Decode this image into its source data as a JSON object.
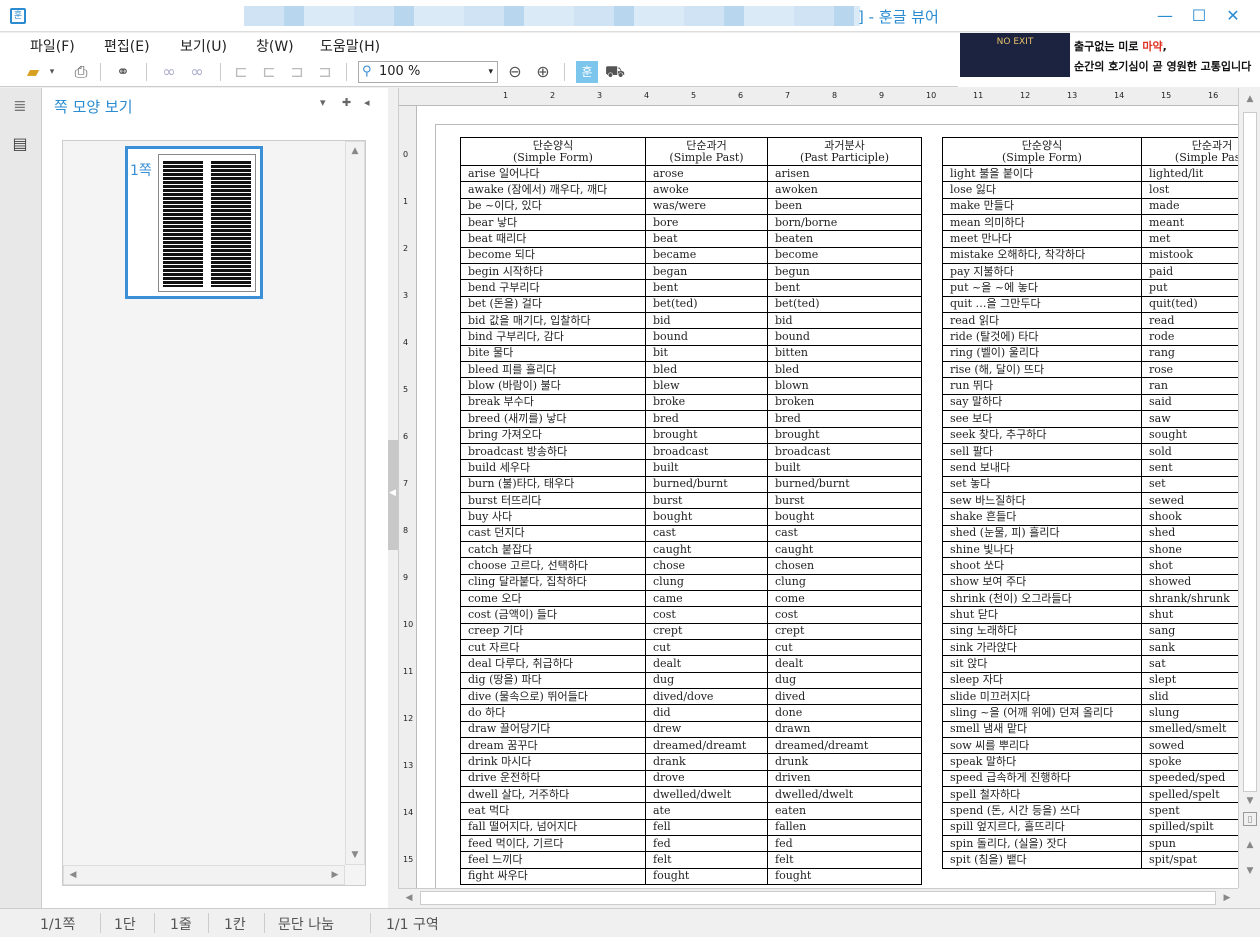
{
  "window": {
    "title_suffix": "] - 훈글 뷰어"
  },
  "menu": [
    "파일(F)",
    "편집(E)",
    "보기(U)",
    "창(W)",
    "도움말(H)"
  ],
  "toolbar": {
    "zoom": "100 %"
  },
  "ad": {
    "line1_prefix": "출구없는 미로 ",
    "line1_highlight": "마약",
    "line1_suffix": ",",
    "line2": "순간의 호기심이 곧 영원한 고통입니다",
    "image_text": "NO EXIT"
  },
  "panel": {
    "title": "쪽 모양 보기",
    "page_label": "1쪽"
  },
  "ruler": {
    "h_ticks": [
      "1",
      "2",
      "3",
      "4",
      "5",
      "6",
      "7",
      "8",
      "9",
      "10",
      "11",
      "12",
      "13",
      "14",
      "15",
      "16"
    ],
    "v_ticks": [
      "0",
      "1",
      "2",
      "3",
      "4",
      "5",
      "6",
      "7",
      "8",
      "9",
      "10",
      "11",
      "12",
      "13",
      "14",
      "15"
    ]
  },
  "table1": {
    "headers": [
      [
        "단순양식",
        "(Simple Form)"
      ],
      [
        "단순과거",
        "(Simple Past)"
      ],
      [
        "과거분사",
        "(Past Participle)"
      ]
    ],
    "rows": [
      [
        "arise 일어나다",
        "arose",
        "arisen"
      ],
      [
        "awake (잠에서) 깨우다, 깨다",
        "awoke",
        "awoken"
      ],
      [
        "be ~이다, 있다",
        "was/were",
        "been"
      ],
      [
        "bear 낳다",
        "bore",
        "born/borne"
      ],
      [
        "beat 때리다",
        "beat",
        "beaten"
      ],
      [
        "become 되다",
        "became",
        "become"
      ],
      [
        "begin 시작하다",
        "began",
        "begun"
      ],
      [
        "bend 구부리다",
        "bent",
        "bent"
      ],
      [
        "bet (돈을) 걸다",
        "bet(ted)",
        "bet(ted)"
      ],
      [
        "bid 값을 매기다, 입찰하다",
        "bid",
        "bid"
      ],
      [
        "bind 구부리다, 감다",
        "bound",
        "bound"
      ],
      [
        "bite 물다",
        "bit",
        "bitten"
      ],
      [
        "bleed 피를 흘리다",
        "bled",
        "bled"
      ],
      [
        "blow (바람이) 불다",
        "blew",
        "blown"
      ],
      [
        "break 부수다",
        "broke",
        "broken"
      ],
      [
        "breed (새끼를) 낳다",
        "bred",
        "bred"
      ],
      [
        "bring 가져오다",
        "brought",
        "brought"
      ],
      [
        "broadcast 방송하다",
        "broadcast",
        "broadcast"
      ],
      [
        "build 세우다",
        "built",
        "built"
      ],
      [
        "burn (불)타다, 태우다",
        "burned/burnt",
        "burned/burnt"
      ],
      [
        "burst 터뜨리다",
        "burst",
        "burst"
      ],
      [
        "buy 사다",
        "bought",
        "bought"
      ],
      [
        "cast 던지다",
        "cast",
        "cast"
      ],
      [
        "catch 붙잡다",
        "caught",
        "caught"
      ],
      [
        "choose 고르다, 선택하다",
        "chose",
        "chosen"
      ],
      [
        "cling 달라붙다, 집착하다",
        "clung",
        "clung"
      ],
      [
        "come 오다",
        "came",
        "come"
      ],
      [
        "cost (금액이) 들다",
        "cost",
        "cost"
      ],
      [
        "creep 기다",
        "crept",
        "crept"
      ],
      [
        "cut 자르다",
        "cut",
        "cut"
      ],
      [
        "deal 다루다, 취급하다",
        "dealt",
        "dealt"
      ],
      [
        "dig (땅을) 파다",
        "dug",
        "dug"
      ],
      [
        "dive (물속으로) 뛰어들다",
        "dived/dove",
        "dived"
      ],
      [
        "do 하다",
        "did",
        "done"
      ],
      [
        "draw 끌어당기다",
        "drew",
        "drawn"
      ],
      [
        "dream 꿈꾸다",
        "dreamed/dreamt",
        "dreamed/dreamt"
      ],
      [
        "drink 마시다",
        "drank",
        "drunk"
      ],
      [
        "drive 운전하다",
        "drove",
        "driven"
      ],
      [
        "dwell 살다, 거주하다",
        "dwelled/dwelt",
        "dwelled/dwelt"
      ],
      [
        "eat 먹다",
        "ate",
        "eaten"
      ],
      [
        "fall 떨어지다, 넘어지다",
        "fell",
        "fallen"
      ],
      [
        "feed 먹이다, 기르다",
        "fed",
        "fed"
      ],
      [
        "feel 느끼다",
        "felt",
        "felt"
      ],
      [
        "fight 싸우다",
        "fought",
        "fought"
      ]
    ]
  },
  "table2": {
    "headers": [
      [
        "단순양식",
        "(Simple Form)"
      ],
      [
        "단순과거",
        "(Simple Past)"
      ]
    ],
    "rows": [
      [
        "light 불을 붙이다",
        "lighted/lit"
      ],
      [
        "lose 잃다",
        "lost"
      ],
      [
        "make 만들다",
        "made"
      ],
      [
        "mean 의미하다",
        "meant"
      ],
      [
        "meet 만나다",
        "met"
      ],
      [
        "mistake 오해하다, 착각하다",
        "mistook"
      ],
      [
        "pay 지불하다",
        "paid"
      ],
      [
        "put ~을 ~에 놓다",
        "put"
      ],
      [
        "quit …을 그만두다",
        "quit(ted)"
      ],
      [
        "read 읽다",
        "read"
      ],
      [
        "ride (탈것에) 타다",
        "rode"
      ],
      [
        "ring (벨이) 울리다",
        "rang"
      ],
      [
        "rise (해, 달이) 뜨다",
        "rose"
      ],
      [
        "run 뛰다",
        "ran"
      ],
      [
        "say 말하다",
        "said"
      ],
      [
        "see 보다",
        "saw"
      ],
      [
        "seek 찾다, 추구하다",
        "sought"
      ],
      [
        "sell 팔다",
        "sold"
      ],
      [
        "send 보내다",
        "sent"
      ],
      [
        "set 놓다",
        "set"
      ],
      [
        "sew 바느질하다",
        "sewed"
      ],
      [
        "shake 흔들다",
        "shook"
      ],
      [
        "shed (눈물, 피) 흘리다",
        "shed"
      ],
      [
        "shine 빛나다",
        "shone"
      ],
      [
        "shoot 쏘다",
        "shot"
      ],
      [
        "show 보여 주다",
        "showed"
      ],
      [
        "shrink (천이) 오그라들다",
        "shrank/shrunk"
      ],
      [
        "shut 닫다",
        "shut"
      ],
      [
        "sing 노래하다",
        "sang"
      ],
      [
        "sink 가라앉다",
        "sank"
      ],
      [
        "sit 앉다",
        "sat"
      ],
      [
        "sleep 자다",
        "slept"
      ],
      [
        "slide 미끄러지다",
        "slid"
      ],
      [
        "sling ~을 (어깨 위에) 던져 올리다",
        "slung"
      ],
      [
        "smell 냄새 맡다",
        "smelled/smelt"
      ],
      [
        "sow 씨를 뿌리다",
        "sowed"
      ],
      [
        "speak 말하다",
        "spoke"
      ],
      [
        "speed 급속하게 진행하다",
        "speeded/sped"
      ],
      [
        "spell 철자하다",
        "spelled/spelt"
      ],
      [
        "spend (돈, 시간 등을) 쓰다",
        "spent"
      ],
      [
        "spill 엎지르다, 흘뜨리다",
        "spilled/spilt"
      ],
      [
        "spin 돌리다, (실을) 잣다",
        "spun"
      ],
      [
        "spit (침을) 뱉다",
        "spit/spat"
      ]
    ]
  },
  "status": [
    "1/1쪽",
    "1단",
    "1줄",
    "1칸",
    "문단 나눔",
    "1/1 구역"
  ]
}
